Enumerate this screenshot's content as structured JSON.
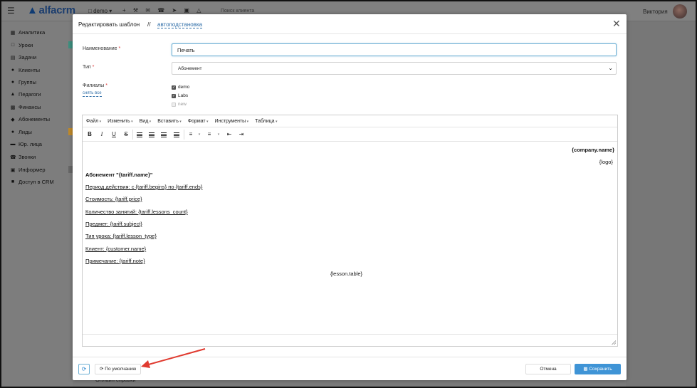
{
  "app": {
    "logo": "alfacrm",
    "branch": "demo",
    "search_placeholder": "Поиск клиента",
    "user_name": "Виктория",
    "top_icons": [
      "plus-icon",
      "wrench-icon",
      "mail-icon",
      "phone-icon",
      "telegram-icon",
      "cart-icon",
      "bell-icon"
    ]
  },
  "sidebar": {
    "items": [
      {
        "label": "Аналитика",
        "icon": "chart-icon"
      },
      {
        "label": "Уроки",
        "icon": "calendar-icon"
      },
      {
        "label": "Задачи",
        "icon": "tasks-icon"
      },
      {
        "label": "Клиенты",
        "icon": "user-icon"
      },
      {
        "label": "Группы",
        "icon": "group-icon"
      },
      {
        "label": "Педагоги",
        "icon": "teacher-icon"
      },
      {
        "label": "Финансы",
        "icon": "money-icon"
      },
      {
        "label": "Абонементы",
        "icon": "tag-icon"
      },
      {
        "label": "Лиды",
        "icon": "leads-icon"
      },
      {
        "label": "Юр. лица",
        "icon": "building-icon"
      },
      {
        "label": "Звонки",
        "icon": "phone-icon"
      },
      {
        "label": "Информер",
        "icon": "informer-icon"
      },
      {
        "label": "Доступ в CRM",
        "icon": "lock-icon"
      }
    ]
  },
  "background_bottom_text": "Онлайн справки",
  "modal": {
    "title": "Редактировать шаблон",
    "separator": "//",
    "link": "автоподстановка",
    "fields": {
      "name_label": "Наименование",
      "name_value": "Печать",
      "type_label": "Тип",
      "type_value": "Абонемент",
      "branches_label": "Филиалы",
      "branches_unselect": "снять все",
      "required_mark": "*",
      "branches": [
        {
          "label": "demo",
          "checked": true,
          "disabled": false
        },
        {
          "label": "Labs",
          "checked": true,
          "disabled": false
        },
        {
          "label": "new",
          "checked": false,
          "disabled": true
        }
      ]
    },
    "editor": {
      "menu": [
        "Файл",
        "Изменить",
        "Вид",
        "Вставить",
        "Формат",
        "Инструменты",
        "Таблица"
      ],
      "toolbar": [
        "bold",
        "italic",
        "underline",
        "strikethrough",
        "align-left",
        "align-center",
        "align-right",
        "justify",
        "bullet-list",
        "numbered-list",
        "outdent",
        "indent"
      ],
      "content": {
        "company": "{company.name}",
        "logo": "{logo}",
        "heading": "Абонемент \"{tariff.name}\"",
        "lines": [
          "Период действия: с {tariff.begins} по {tariff.ends}",
          "Стоимость: {tariff.price}",
          "Количество занятий: {tariff.lessons_count}",
          "Предмет: {tariff.subject}",
          "Тип урока: {tariff.lesson_type}",
          "Клиент: {customer.name}",
          "Примечание: {tariff.note}"
        ],
        "table": "{lesson.table}"
      }
    },
    "footer": {
      "default_label": "По умолчанию",
      "cancel_label": "Отмена",
      "save_label": "Сохранить"
    }
  },
  "colors": {
    "accent": "#3f94d6",
    "link": "#2f6ea8",
    "required": "#dd3333",
    "annotation_arrow": "#e03a2f"
  }
}
